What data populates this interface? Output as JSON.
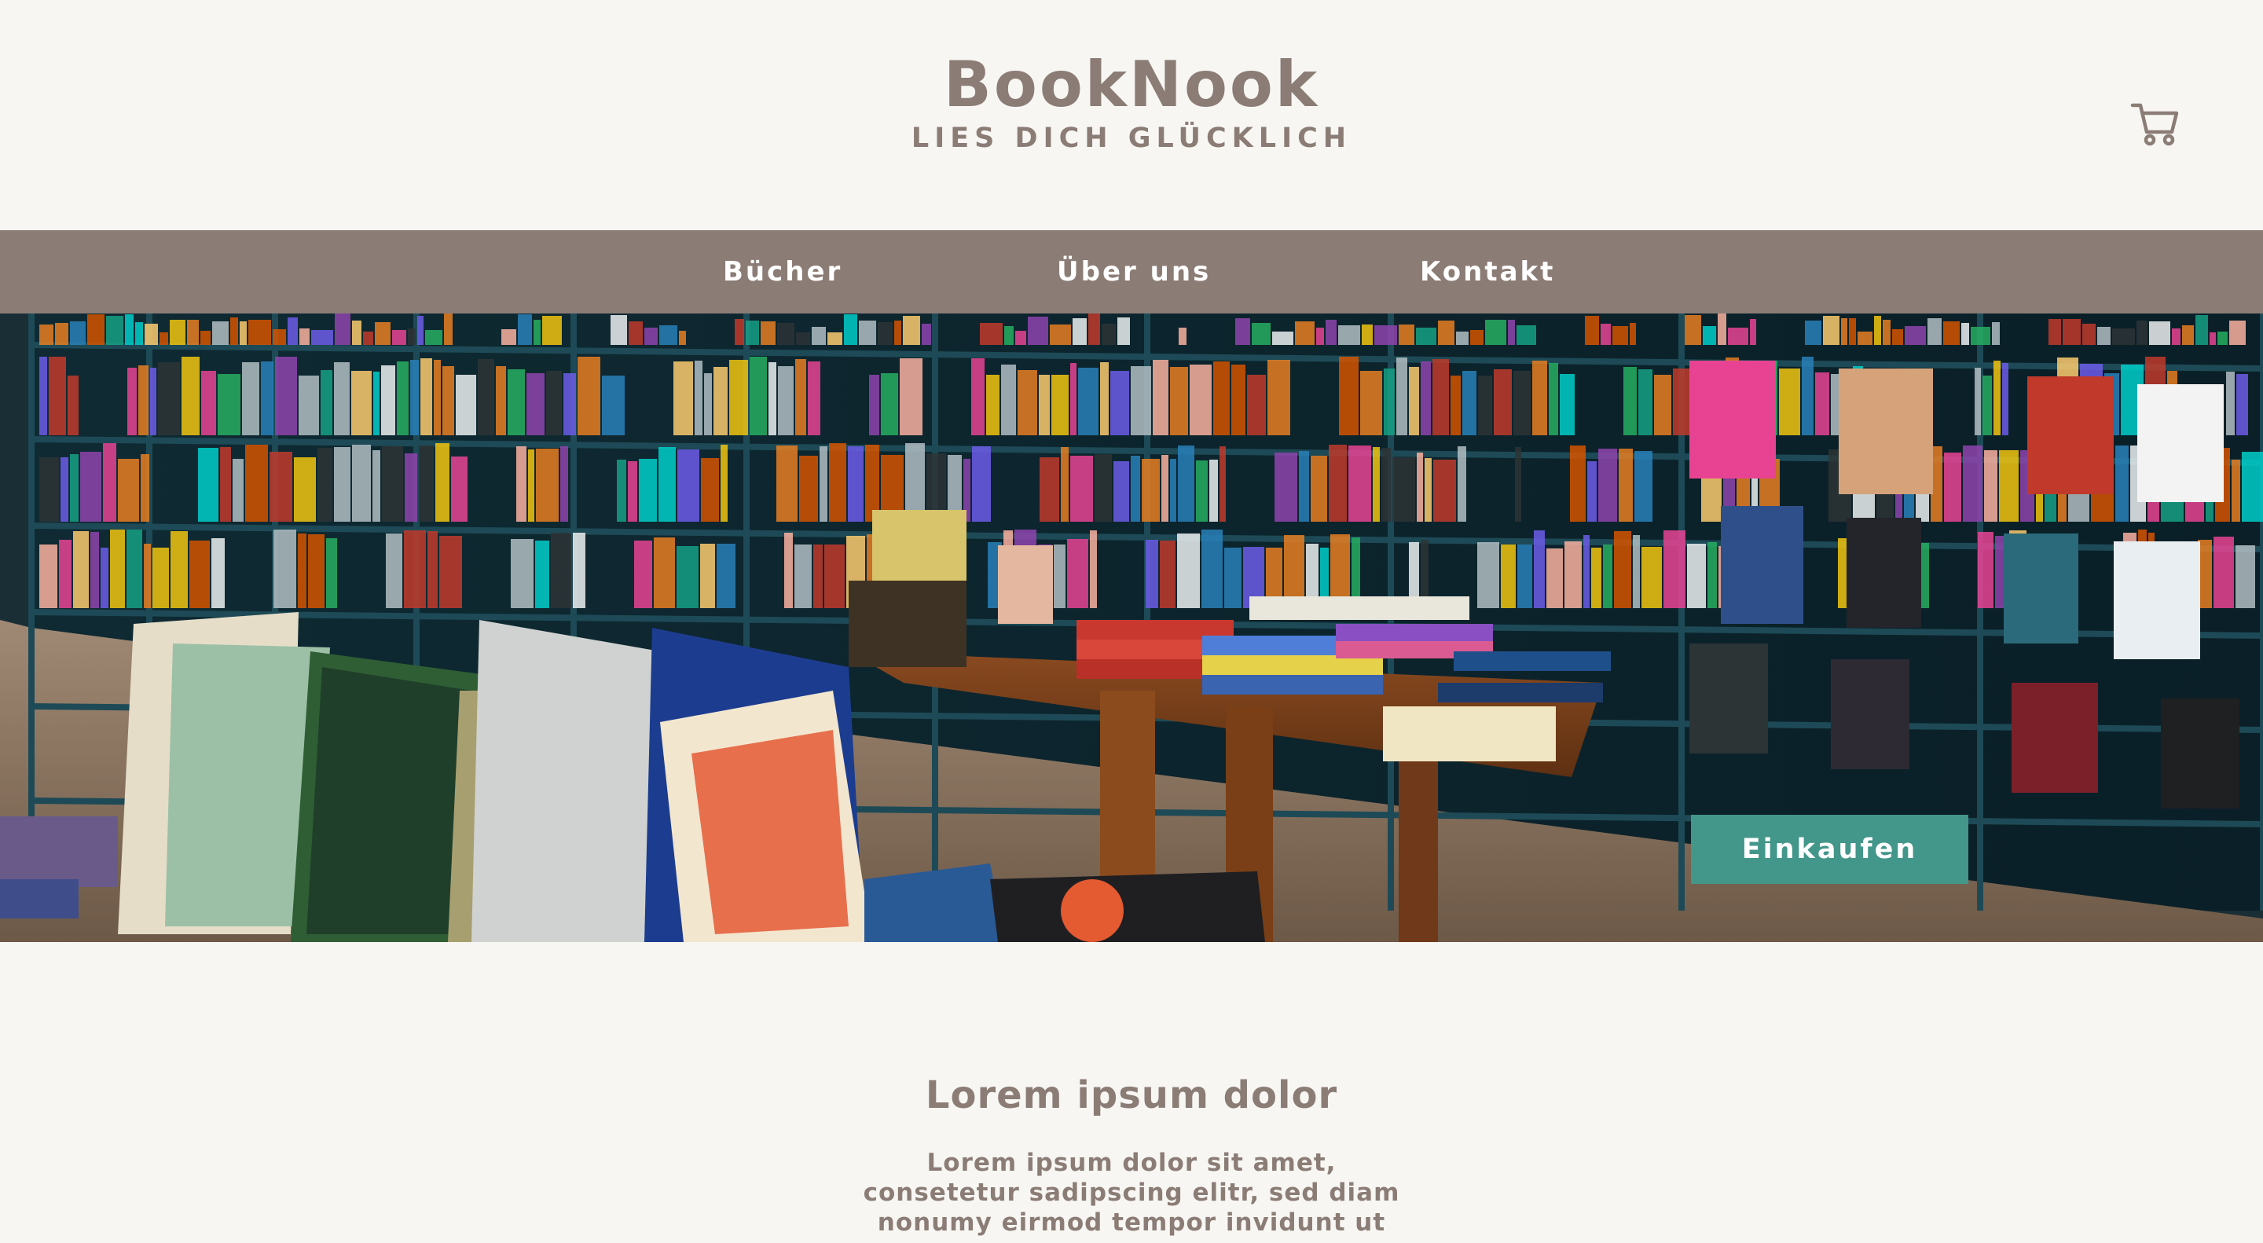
{
  "header": {
    "title": "BookNook",
    "tagline": "LIES DICH GLÜCKLICH",
    "cart_icon": "cart-icon"
  },
  "nav": {
    "items": [
      {
        "label": "Bücher"
      },
      {
        "label": "Über uns"
      },
      {
        "label": "Kontakt"
      }
    ]
  },
  "hero": {
    "image": "bookstore-shelves-photo",
    "cta_label": "Einkaufen",
    "cta_color": "#43968a"
  },
  "intro": {
    "heading": "Lorem ipsum dolor",
    "text": "Lorem ipsum dolor sit amet, consetetur sadipscing elitr, sed diam nonumy eirmod tempor invidunt ut"
  },
  "colors": {
    "brand": "#8b7c76",
    "background": "#f7f6f2",
    "accent": "#43968a"
  }
}
